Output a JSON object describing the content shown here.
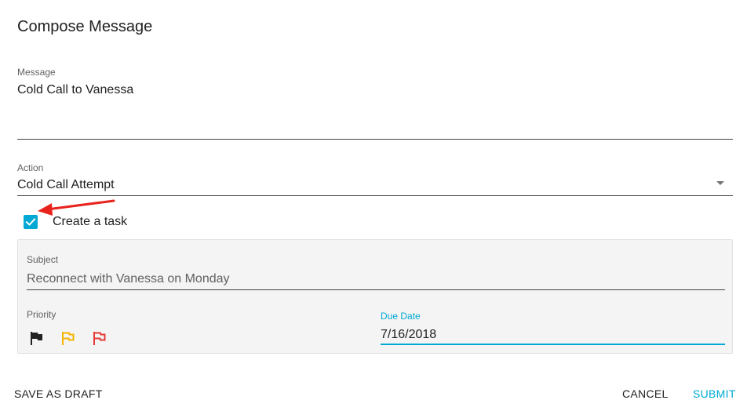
{
  "dialog": {
    "title": "Compose Message"
  },
  "message": {
    "label": "Message",
    "value": "Cold Call to Vanessa"
  },
  "action": {
    "label": "Action",
    "value": "Cold Call Attempt"
  },
  "create_task": {
    "label": "Create a task",
    "checked": true
  },
  "task": {
    "subject_label": "Subject",
    "subject_value": "Reconnect with Vanessa on Monday",
    "priority_label": "Priority",
    "priority_flags": [
      {
        "name": "flag-black-icon",
        "color": "#212121",
        "filled": true
      },
      {
        "name": "flag-yellow-icon",
        "color": "#f5b400",
        "filled": false
      },
      {
        "name": "flag-red-icon",
        "color": "#e53935",
        "filled": false
      }
    ],
    "due_date_label": "Due Date",
    "due_date_value": "7/16/2018"
  },
  "buttons": {
    "save_draft": "SAVE AS DRAFT",
    "cancel": "CANCEL",
    "submit": "SUBMIT"
  },
  "colors": {
    "accent": "#00a9d4",
    "annotation_arrow": "#e8231d"
  }
}
